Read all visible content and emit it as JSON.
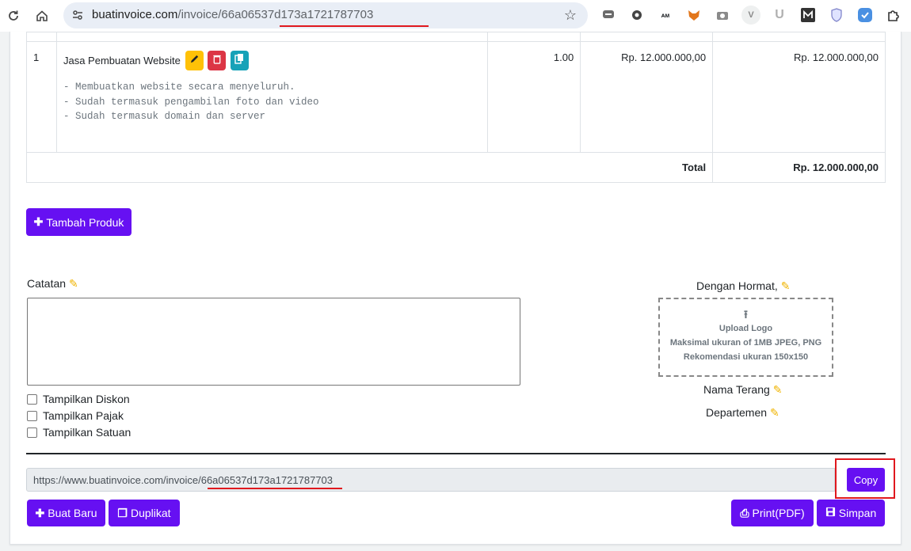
{
  "browser": {
    "domain": "buatinvoice.com",
    "path": "/invoice/66a06537d173a1721787703",
    "extensions": [
      "chat-icon",
      "gear-icon",
      "text-badge-icon",
      "fox-icon",
      "camera-icon",
      "v-icon",
      "u-icon",
      "m-icon",
      "shield-icon",
      "check-icon",
      "puzzle-icon"
    ],
    "ext_badge_text": "ᴀᴍ"
  },
  "invoice": {
    "items": [
      {
        "num": "1",
        "name": "Jasa Pembuatan Website",
        "description": [
          "- Membuatkan website secara menyeluruh.",
          "- Sudah termasuk pengambilan foto dan video",
          "- Sudah termasuk domain dan server"
        ],
        "qty": "1.00",
        "price": "Rp. 12.000.000,00",
        "amount": "Rp. 12.000.000,00"
      }
    ],
    "total_label": "Total",
    "total_value": "Rp. 12.000.000,00"
  },
  "actions": {
    "add_product": "Tambah Produk",
    "new": "Buat Baru",
    "duplicate": "Duplikat",
    "print": "Print(PDF)",
    "save": "Simpan",
    "copy": "Copy"
  },
  "notes": {
    "label": "Catatan",
    "value": ""
  },
  "options": {
    "discount": "Tampilkan Diskon",
    "tax": "Tampilkan Pajak",
    "unit": "Tampilkan Satuan"
  },
  "signature": {
    "greeting": "Dengan Hormat,",
    "upload_title": "Upload Logo",
    "upload_line1": "Maksimal ukuran of 1MB JPEG, PNG",
    "upload_line2": "Rekomendasi ukuran 150x150",
    "name_label": "Nama Terang",
    "dept_label": "Departemen"
  },
  "share": {
    "url_prefix": "https://www.buatinvoice.com/invoice/",
    "url_id": "66a06537d173a1721787703"
  },
  "colors": {
    "primary": "#6610f2",
    "warning": "#ffc107",
    "danger": "#dc3545",
    "info": "#17a2b8",
    "annotation": "#e0181e"
  }
}
